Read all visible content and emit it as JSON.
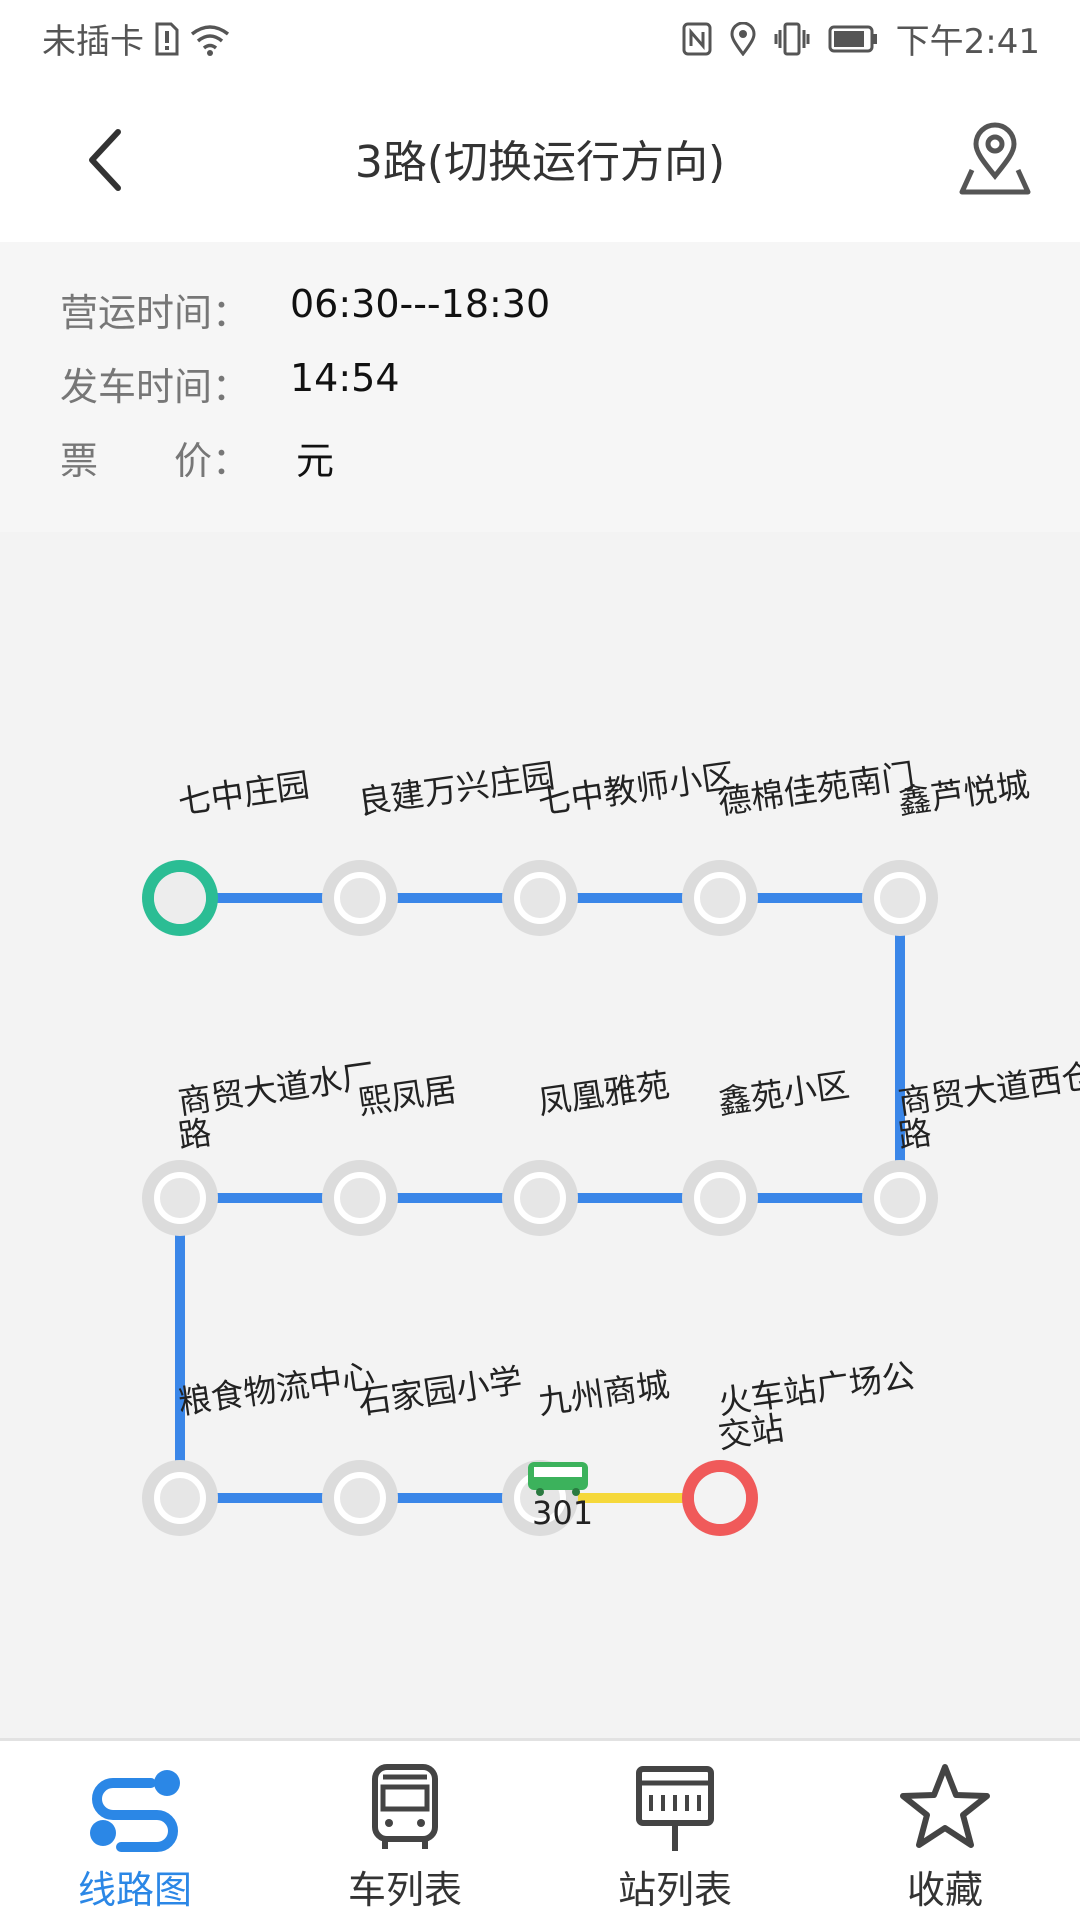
{
  "status_bar": {
    "carrier": "未插卡",
    "time": "下午2:41",
    "icons": [
      "sim-alert-icon",
      "wifi-icon",
      "nfc-icon",
      "location-icon",
      "vibrate-icon",
      "battery-icon"
    ]
  },
  "header": {
    "title": "3路(切换运行方向)",
    "back_icon": "chevron-left-icon",
    "map_icon": "map-pin-icon"
  },
  "info": {
    "service_hours_label": "营运时间：",
    "service_hours": "06:30---18:30",
    "departure_label": "发车时间：",
    "departure": "14:54",
    "fare_label": "票　　价：",
    "fare": "元"
  },
  "route": {
    "stops": [
      {
        "name": "七中庄园",
        "type": "start"
      },
      {
        "name": "良建万兴庄园",
        "type": "normal"
      },
      {
        "name": "七中教师小区",
        "type": "normal"
      },
      {
        "name": "德棉佳苑南门",
        "type": "normal"
      },
      {
        "name": "鑫芦悦城",
        "type": "normal"
      },
      {
        "name": "商贸大道西仓路",
        "type": "normal"
      },
      {
        "name": "鑫苑小区",
        "type": "normal"
      },
      {
        "name": "凤凰雅苑",
        "type": "normal"
      },
      {
        "name": "熙凤居",
        "type": "normal"
      },
      {
        "name": "商贸大道水厂路",
        "type": "normal"
      },
      {
        "name": "粮食物流中心",
        "type": "normal"
      },
      {
        "name": "石家园小学",
        "type": "normal"
      },
      {
        "name": "九州商城",
        "type": "normal"
      },
      {
        "name": "火车站广场公交站",
        "type": "end"
      }
    ],
    "bus": {
      "number": "301",
      "icon": "bus-icon",
      "at_stop": 12
    },
    "colors": {
      "line": "#3a86e8",
      "current_segment": "#f5d83a",
      "start": "#2bbd94",
      "end": "#f05a5a",
      "stop": "#dcdcdc"
    }
  },
  "bottom_nav": [
    {
      "label": "线路图",
      "icon": "route-icon",
      "active": true
    },
    {
      "label": "车列表",
      "icon": "bus-front-icon",
      "active": false
    },
    {
      "label": "站列表",
      "icon": "station-sign-icon",
      "active": false
    },
    {
      "label": "收藏",
      "icon": "star-icon",
      "active": false
    }
  ]
}
